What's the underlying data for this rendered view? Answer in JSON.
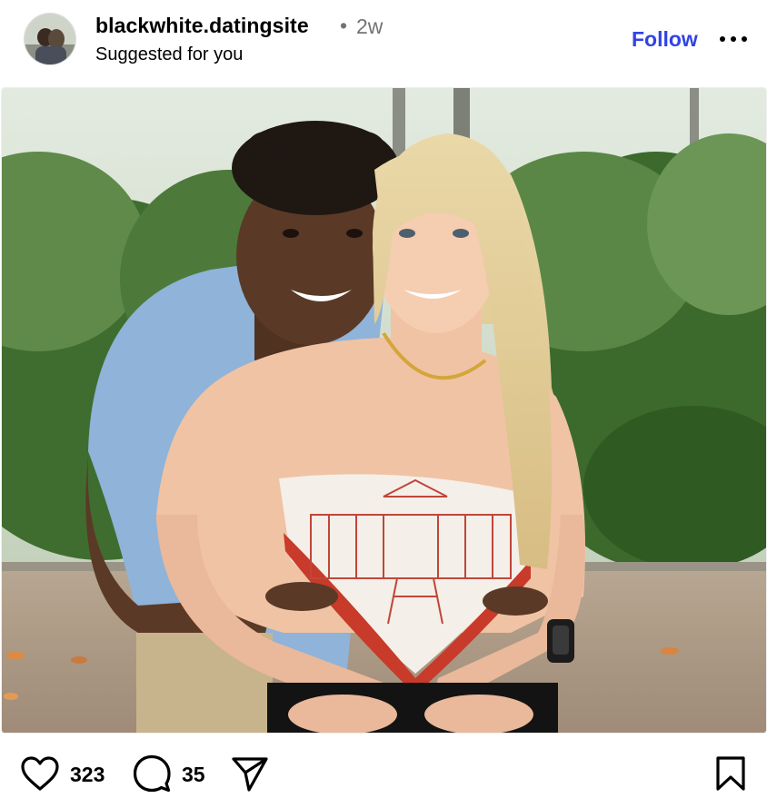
{
  "post": {
    "username": "blackwhite.datingsite",
    "separator": "•",
    "time": "2w",
    "subtitle": "Suggested for you",
    "follow_label": "Follow"
  },
  "media": {
    "description_icon": "photo",
    "accent_colors": {
      "sky": "#dfe8de",
      "foliage": "#3d6a2e",
      "shirt": "#8fb3d9",
      "hair": "#e2c98f",
      "top": "#c83a2a",
      "ground": "#a89582"
    }
  },
  "actions": {
    "likes": "323",
    "comments": "35",
    "icons": [
      "heart-icon",
      "comment-icon",
      "share-icon",
      "bookmark-icon"
    ]
  },
  "colors": {
    "follow": "#3143e5",
    "muted": "#737373"
  }
}
